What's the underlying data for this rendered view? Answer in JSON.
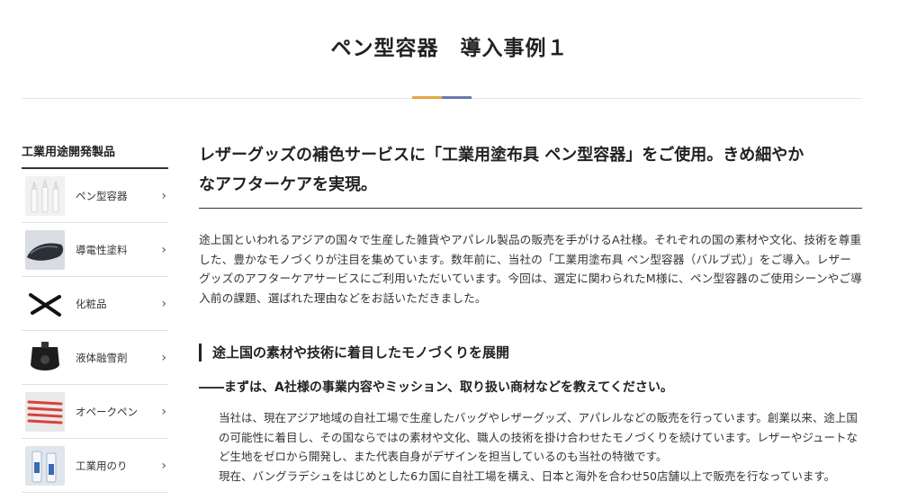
{
  "page": {
    "title": "ペン型容器　導入事例１"
  },
  "sidebar": {
    "heading": "工業用途開発製品",
    "items": [
      {
        "label": "ペン型容器",
        "icon": "pen-container-thumbnail"
      },
      {
        "label": "導電性塗料",
        "icon": "conductive-paint-thumbnail"
      },
      {
        "label": "化粧品",
        "icon": "cosmetics-thumbnail"
      },
      {
        "label": "液体融雪剤",
        "icon": "snow-melting-agent-thumbnail"
      },
      {
        "label": "オペークペン",
        "icon": "opaque-pen-thumbnail"
      },
      {
        "label": "工業用のり",
        "icon": "industrial-glue-thumbnail"
      }
    ],
    "chevron": "›"
  },
  "main": {
    "lead_heading_line1": "レザーグッズの補色サービスに「工業用塗布具 ペン型容器」をご使用。きめ細やか",
    "lead_heading_line2": "なアフターケアを実現。",
    "intro": "途上国といわれるアジアの国々で生産した雑貨やアパレル製品の販売を手がけるA社様。それぞれの国の素材や文化、技術を尊重した、豊かなモノづくりが注目を集めています。数年前に、当社の「工業用塗布具 ペン型容器（バルブ式）」をご導入。レザーグッズのアフターケアサービスにご利用いただいています。今回は、選定に関わられたM様に、ペン型容器のご使用シーンやご導入前の課題、選ばれた理由などをお話いただきました。",
    "section_heading": "途上国の素材や技術に着目したモノづくりを展開",
    "question": "――まずは、A社様の事業内容やミッション、取り扱い商材などを教えてください。",
    "answer_p1": "当社は、現在アジア地域の自社工場で生産したバッグやレザーグッズ、アパレルなどの販売を行っています。創業以来、途上国の可能性に着目し、その国ならではの素材や文化、職人の技術を掛け合わせたモノづくりを続けています。レザーやジュートなど生地をゼロから開発し、また代表自身がデザインを担当しているのも当社の特徴です。",
    "answer_p2": "現在、バングラデシュをはじめとした6カ国に自社工場を構え、日本と海外を合わせ50店舗以上で販売を行なっています。"
  },
  "colors": {
    "accent_orange": "#e3a640",
    "accent_blue": "#6a79b1"
  }
}
